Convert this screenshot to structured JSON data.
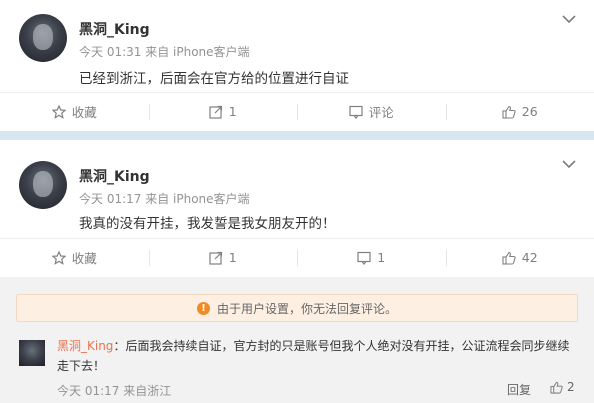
{
  "post1": {
    "nickname": "黑洞_King",
    "meta": "今天 01:31 来自 iPhone客户端",
    "text": "已经到浙江，后面会在官方给的位置进行自证",
    "actions": {
      "favorite": "收藏",
      "repost": "1",
      "comment": "评论",
      "like": "26"
    }
  },
  "post2": {
    "nickname": "黑洞_King",
    "meta": "今天 01:17 来自 iPhone客户端",
    "text": "我真的没有开挂，我发誓是我女朋友开的！",
    "actions": {
      "favorite": "收藏",
      "repost": "1",
      "comment": "1",
      "like": "42"
    },
    "notice": "由于用户设置，你无法回复评论。",
    "comment": {
      "user": "黑洞_King",
      "separator": "：",
      "text": "后面我会持续自证，官方封的只是账号但我个人绝对没有开挂，公证流程会同步继续走下去！",
      "meta": "今天 01:17 来自浙江",
      "reply": "回复",
      "likes": "2"
    }
  },
  "colors": {
    "divider": "#d7e7f0",
    "comment_user": "#eb7350",
    "notice_bg": "#fdf0e3",
    "warn_icon": "#f08a24"
  }
}
